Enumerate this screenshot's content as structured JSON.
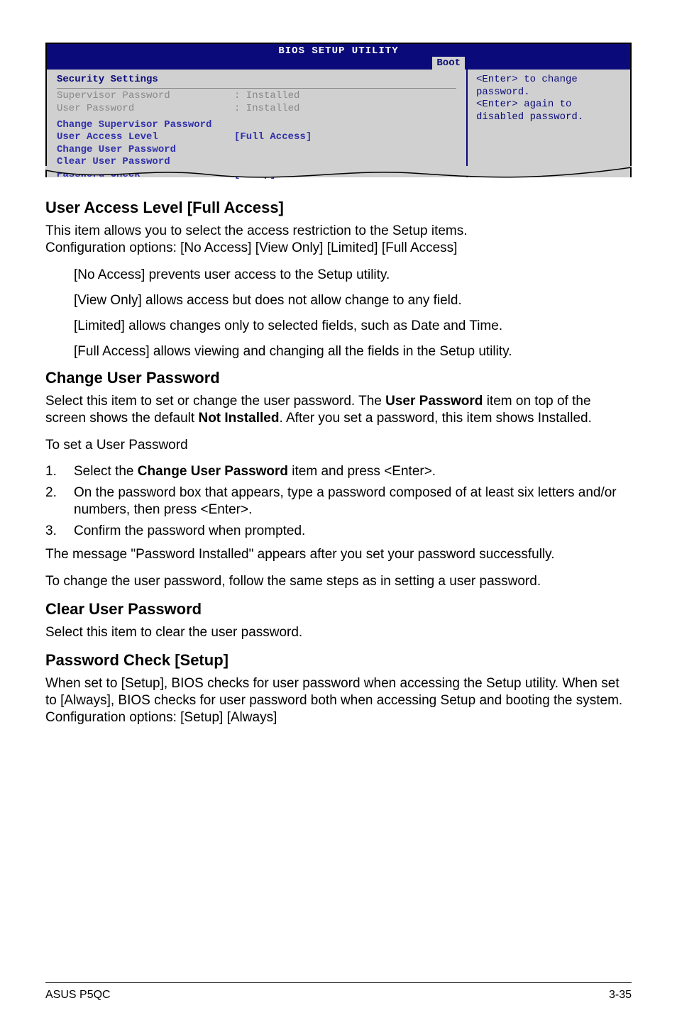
{
  "bios": {
    "title": "BIOS SETUP UTILITY",
    "tab": "Boot",
    "left": {
      "heading": "Security Settings",
      "supervisor_label": "Supervisor Password",
      "supervisor_value": ": Installed",
      "user_label": "User Password",
      "user_value": ": Installed",
      "change_supervisor": "Change Supervisor Password",
      "user_access_label": "User Access Level",
      "user_access_value": "[Full Access]",
      "change_user": "Change User Password",
      "clear_user": "Clear User Password",
      "pwcheck_label": "Password Check",
      "pwcheck_value": "[Setup]"
    },
    "right": {
      "line1": "<Enter> to change",
      "line2": "password.",
      "line3": "<Enter> again to",
      "line4": "disabled password."
    }
  },
  "sections": {
    "user_access": {
      "heading": "User Access Level [Full Access]",
      "p1a": "This item allows you to select the access restriction to the Setup items.",
      "p1b": "Configuration options: [No Access] [View Only] [Limited] [Full Access]",
      "no_access": "[No Access] prevents user access to the Setup utility.",
      "view_only": "[View Only] allows access but does not allow change to any field.",
      "limited": "[Limited] allows changes only to selected fields, such as Date and Time.",
      "full_access": "[Full Access] allows viewing and changing all the fields in the Setup utility."
    },
    "change_user": {
      "heading": "Change User Password",
      "p1_pre": "Select this item to set or change the user password. The ",
      "p1_bold1": "User Password",
      "p1_mid": " item on top of the screen shows the default ",
      "p1_bold2": "Not Installed",
      "p1_post": ". After you set a password, this item shows Installed.",
      "p2": "To set a User Password",
      "li1_pre": "Select the ",
      "li1_bold": "Change User Password",
      "li1_post": " item and press <Enter>.",
      "li2": "On the password box that appears, type a password composed of at least six letters and/or numbers, then press <Enter>.",
      "li3": "Confirm the password when prompted.",
      "p3": "The message \"Password Installed\" appears after you set your password successfully.",
      "p4": "To change the user password, follow the same steps as in setting a user password."
    },
    "clear_user": {
      "heading": "Clear User Password",
      "p1": "Select this item to clear the user password."
    },
    "pwcheck": {
      "heading": "Password Check [Setup]",
      "p1": "When set to [Setup], BIOS checks for user password when accessing the Setup utility. When set to [Always], BIOS checks for user password both when accessing Setup and booting the system.",
      "p2": "Configuration options: [Setup] [Always]"
    }
  },
  "footer": {
    "left": "ASUS P5QC",
    "right": "3-35"
  }
}
